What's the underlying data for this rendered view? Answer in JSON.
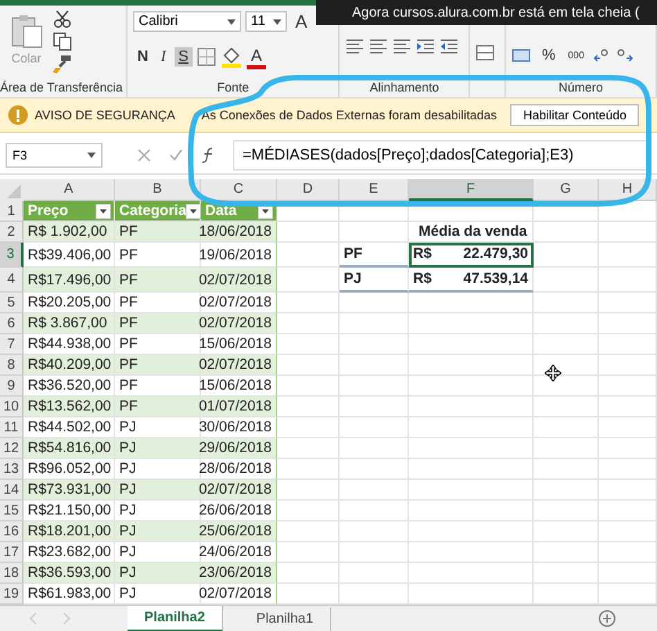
{
  "notice": {
    "text": "Agora cursos.alura.com.br está em tela cheia ("
  },
  "ribbon": {
    "paste_label": "Colar",
    "font_name": "Calibri",
    "font_size": "11",
    "grow_font": "A",
    "bold": "N",
    "italic": "I",
    "underline": "S",
    "font_color": "A",
    "percent": "%",
    "thousands": "000",
    "groups": [
      {
        "label": "Área de Transferência"
      },
      {
        "label": "Fonte"
      },
      {
        "label": "Alinhamento"
      },
      {
        "label": "Número"
      }
    ]
  },
  "security_bar": {
    "title": "AVISO DE SEGURANÇA",
    "message": "As Conexões de Dados Externas foram desabilitadas",
    "button": "Habilitar Conteúdo"
  },
  "formula_bar": {
    "name_box": "F3",
    "formula": "=MÉDIASES(dados[Preço];dados[Categoria];E3)"
  },
  "columns": [
    {
      "label": "A",
      "selected": false
    },
    {
      "label": "B",
      "selected": false
    },
    {
      "label": "C",
      "selected": false
    },
    {
      "label": "D",
      "selected": false
    },
    {
      "label": "E",
      "selected": false
    },
    {
      "label": "F",
      "selected": true
    },
    {
      "label": "G",
      "selected": false
    },
    {
      "label": "H",
      "selected": false
    }
  ],
  "row_headers": [
    "1",
    "2",
    "3",
    "4",
    "5",
    "6",
    "7",
    "8",
    "9",
    "10",
    "11",
    "12",
    "13",
    "14",
    "15",
    "16",
    "17",
    "18",
    "19"
  ],
  "table": {
    "headers": [
      "Preço",
      "Categoria",
      "Data"
    ],
    "rows": [
      [
        "R$ 1.902,00",
        "PF",
        "18/06/2018"
      ],
      [
        "R$39.406,00",
        "PF",
        "19/06/2018"
      ],
      [
        "R$17.496,00",
        "PF",
        "02/07/2018"
      ],
      [
        "R$20.205,00",
        "PF",
        "02/07/2018"
      ],
      [
        "R$ 3.867,00",
        "PF",
        "02/07/2018"
      ],
      [
        "R$44.938,00",
        "PF",
        "15/06/2018"
      ],
      [
        "R$40.209,00",
        "PF",
        "02/07/2018"
      ],
      [
        "R$36.520,00",
        "PF",
        "15/06/2018"
      ],
      [
        "R$13.562,00",
        "PF",
        "01/07/2018"
      ],
      [
        "R$44.502,00",
        "PJ",
        "30/06/2018"
      ],
      [
        "R$54.816,00",
        "PJ",
        "29/06/2018"
      ],
      [
        "R$96.052,00",
        "PJ",
        "28/06/2018"
      ],
      [
        "R$73.931,00",
        "PJ",
        "02/07/2018"
      ],
      [
        "R$21.150,00",
        "PJ",
        "26/06/2018"
      ],
      [
        "R$18.201,00",
        "PJ",
        "25/06/2018"
      ],
      [
        "R$23.682,00",
        "PJ",
        "24/06/2018"
      ],
      [
        "R$36.593,00",
        "PJ",
        "23/06/2018"
      ],
      [
        "R$61.983,00",
        "PJ",
        "02/07/2018"
      ]
    ]
  },
  "summary": {
    "title": "Média da venda",
    "items": [
      {
        "label": "PF",
        "currency": "R$",
        "value": "22.479,30",
        "selected": true
      },
      {
        "label": "PJ",
        "currency": "R$",
        "value": "47.539,14",
        "selected": false
      }
    ]
  },
  "sheet_tabs": [
    {
      "label": "Planilha2",
      "selected": true
    },
    {
      "label": "Planilha1",
      "selected": false
    }
  ]
}
